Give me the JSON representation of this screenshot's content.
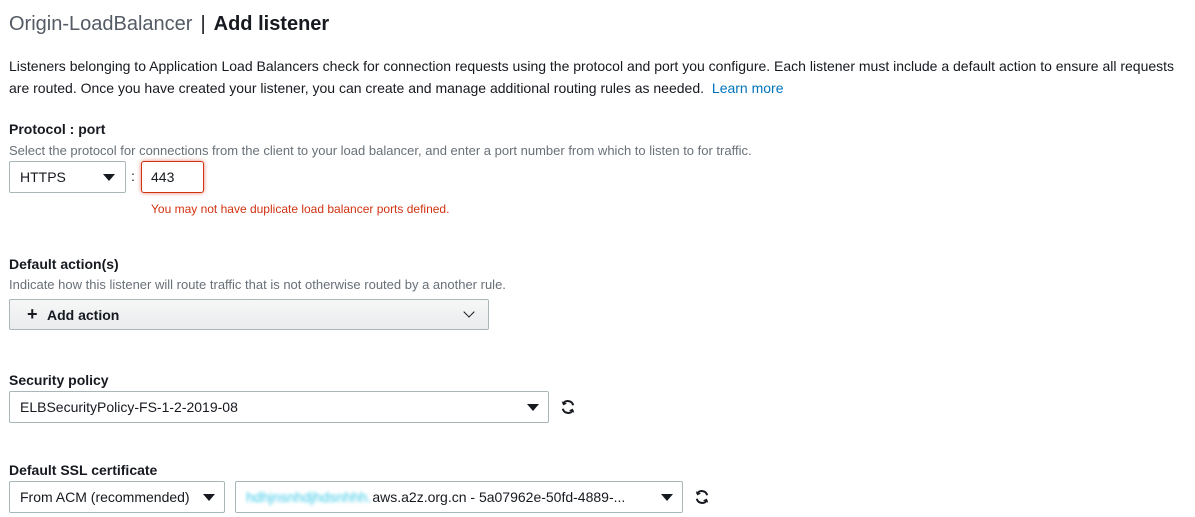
{
  "header": {
    "load_balancer_name": "Origin-LoadBalancer",
    "separator": "|",
    "page_title": "Add listener"
  },
  "intro": {
    "text": "Listeners belonging to Application Load Balancers check for connection requests using the protocol and port you configure. Each listener must include a default action to ensure all requests are routed. Once you have created your listener, you can create and manage additional routing rules as needed.",
    "learn_more": "Learn more"
  },
  "protocol_port": {
    "label": "Protocol : port",
    "description": "Select the protocol for connections from the client to your load balancer, and enter a port number from which to listen to for traffic.",
    "protocol_value": "HTTPS",
    "colon": ":",
    "port_value": "443",
    "error": "You may not have duplicate load balancer ports defined."
  },
  "default_actions": {
    "label": "Default action(s)",
    "description": "Indicate how this listener will route traffic that is not otherwise routed by a another rule.",
    "add_action_label": "Add action"
  },
  "security_policy": {
    "label": "Security policy",
    "value": "ELBSecurityPolicy-FS-1-2-2019-08"
  },
  "ssl_certificate": {
    "label": "Default SSL certificate",
    "source_value": "From ACM (recommended)",
    "certificate_redacted": "hdhjnsnhdjhdsnhhh.",
    "certificate_value": "aws.a2z.org.cn - 5a07962e-50fd-4889-..."
  },
  "colors": {
    "error": "#d13212",
    "link": "#0073bb",
    "border": "#aab7b8"
  },
  "icons": {
    "dropdown": "caret-down-icon",
    "refresh": "refresh-icon",
    "add": "plus-icon",
    "chevron": "chevron-down-icon"
  }
}
